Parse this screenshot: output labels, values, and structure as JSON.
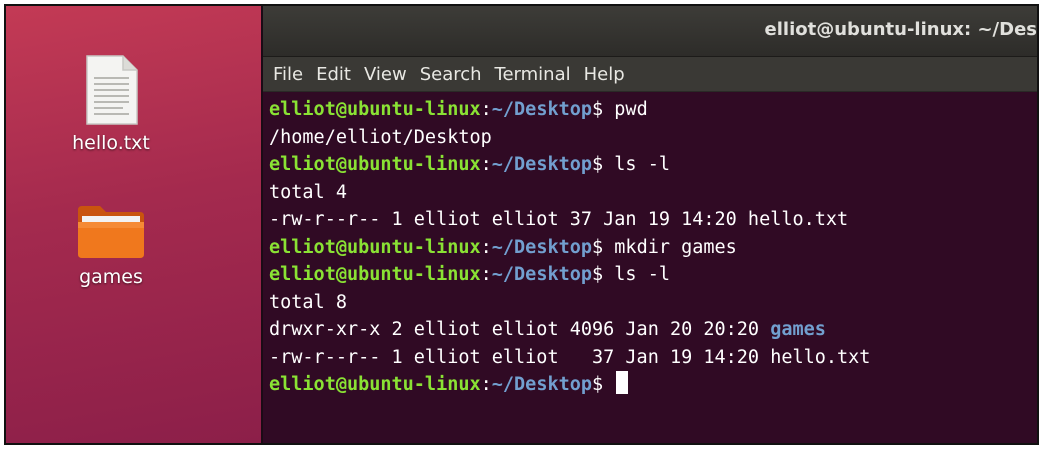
{
  "window": {
    "title": "elliot@ubuntu-linux: ~/Des"
  },
  "menu": [
    {
      "label": "File"
    },
    {
      "label": "Edit"
    },
    {
      "label": "View"
    },
    {
      "label": "Search"
    },
    {
      "label": "Terminal"
    },
    {
      "label": "Help"
    }
  ],
  "desktop": {
    "icons": [
      {
        "label": "hello.txt",
        "icon": "text-file-icon"
      },
      {
        "label": "games",
        "icon": "folder-icon"
      }
    ]
  },
  "prompt": {
    "user": "elliot@ubuntu-linux",
    "sep": ":",
    "path": "~/Desktop",
    "sym": "$ "
  },
  "terminal": {
    "cmd1": "pwd",
    "out1": "/home/elliot/Desktop",
    "cmd2": "ls -l",
    "out2a": "total 4",
    "out2b": "-rw-r--r-- 1 elliot elliot 37 Jan 19 14:20 hello.txt",
    "cmd3": "mkdir games",
    "cmd4": "ls -l",
    "out4a": "total 8",
    "out4b_prefix": "drwxr-xr-x 2 elliot elliot 4096 Jan 20 20:20 ",
    "out4b_dir": "games",
    "out4c": "-rw-r--r-- 1 elliot elliot   37 Jan 19 14:20 hello.txt"
  },
  "colors": {
    "terminal_bg": "#300a24",
    "prompt_user": "#8ae234",
    "prompt_path": "#729fcf",
    "desktop_bg": "#a42a4e"
  }
}
